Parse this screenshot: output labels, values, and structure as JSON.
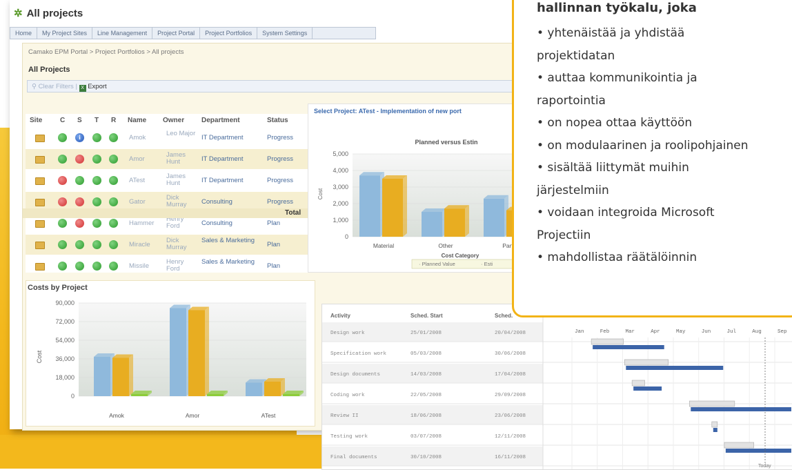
{
  "app": {
    "title": "All projects"
  },
  "nav_tabs": [
    "Home",
    "My Project Sites",
    "Line Management",
    "Project Portal",
    "Project Portfolios",
    "System Settings"
  ],
  "breadcrumb": "Camako EPM Portal > Project Portfolios > All projects",
  "section_title": "All Projects",
  "toolbar": {
    "clear_filters": "Clear Filters",
    "export": "Export"
  },
  "grid": {
    "columns": [
      "Site",
      "C",
      "S",
      "T",
      "R",
      "Name",
      "Owner",
      "Department",
      "Status"
    ],
    "rows": [
      {
        "status_dots": [
          "green",
          "info",
          "green",
          "green"
        ],
        "name": "Amok",
        "owner": "Leo Major",
        "department": "IT Department",
        "status": "Progress"
      },
      {
        "status_dots": [
          "green",
          "red",
          "green",
          "green"
        ],
        "name": "Amor",
        "owner": "James Hunt",
        "department": "IT Department",
        "status": "Progress"
      },
      {
        "status_dots": [
          "red",
          "green",
          "green",
          "green"
        ],
        "name": "ATest",
        "owner": "James Hunt",
        "department": "IT Department",
        "status": "Progress"
      },
      {
        "status_dots": [
          "red",
          "red",
          "green",
          "green"
        ],
        "name": "Gator",
        "owner": "Dick Murray",
        "department": "Consulting",
        "status": "Progress"
      },
      {
        "status_dots": [
          "green",
          "red",
          "green",
          "green"
        ],
        "name": "Hammer",
        "owner": "Henry Ford",
        "department": "Consulting",
        "status": "Plan"
      },
      {
        "status_dots": [
          "green",
          "green",
          "green",
          "green"
        ],
        "name": "Miracle",
        "owner": "Dick Murray",
        "department": "Sales & Marketing",
        "status": "Plan"
      },
      {
        "status_dots": [
          "green",
          "green",
          "green",
          "green"
        ],
        "name": "Missile",
        "owner": "Henry Ford",
        "department": "Sales & Marketing",
        "status": "Plan"
      }
    ],
    "total_label": "Total"
  },
  "costs_chart": {
    "title": "Costs by Project",
    "ylabel": "Cost",
    "yticks": [
      "90,000",
      "72,000",
      "54,000",
      "36,000",
      "18,000",
      "0"
    ],
    "categories": [
      "Amok",
      "Amor",
      "ATest"
    ],
    "series": [
      {
        "values": [
          38000,
          85000,
          13000
        ],
        "color": "#8fb9dc"
      },
      {
        "values": [
          37000,
          83000,
          14000
        ],
        "color": "#e8ad21"
      },
      {
        "values": [
          2000,
          2000,
          2000
        ],
        "color": "#8ccc3a"
      }
    ]
  },
  "select_project": {
    "title": "Select Project: ATest - Implementation of new port",
    "chart_title": "Planned versus Estin",
    "ylabel": "Cost",
    "yticks": [
      "5,000",
      "4,000",
      "3,000",
      "2,000",
      "1,000",
      "0"
    ],
    "categories": [
      "Material",
      "Other",
      "Part"
    ],
    "xlabel": "Cost Category",
    "legend": [
      "Planned Value",
      "Esti"
    ],
    "series": [
      {
        "values": [
          3700,
          1500,
          2300
        ],
        "color": "#8fb9dc"
      },
      {
        "values": [
          3500,
          1700,
          1600
        ],
        "color": "#e8ad21"
      }
    ]
  },
  "gantt": {
    "columns": [
      "Activity",
      "Sched. Start",
      "Sched."
    ],
    "rows": [
      {
        "activity": "Design work",
        "start": "25/01/2008",
        "end": "20/04/2008"
      },
      {
        "activity": "Specification work",
        "start": "05/03/2008",
        "end": "30/06/2008"
      },
      {
        "activity": "Design documents",
        "start": "14/03/2008",
        "end": "17/04/2008"
      },
      {
        "activity": "Coding work",
        "start": "22/05/2008",
        "end": "29/09/2008"
      },
      {
        "activity": "Review II",
        "start": "18/06/2008",
        "end": "23/06/2008"
      },
      {
        "activity": "Testing work",
        "start": "03/07/2008",
        "end": "12/11/2008"
      },
      {
        "activity": "Final documents",
        "start": "30/10/2008",
        "end": "16/11/2008"
      }
    ],
    "months": [
      "Jan",
      "Feb",
      "Mar",
      "Apr",
      "May",
      "Jun",
      "Jul",
      "Aug",
      "Sep"
    ],
    "today_label": "Today"
  },
  "info_box": {
    "heading": "hallinnan työkalu, joka",
    "lines": [
      "• yhtenäistää ja yhdistää",
      "projektidatan",
      "• auttaa kommunikointia ja",
      "raportointia",
      "• on nopea ottaa käyttöön",
      "• on modulaarinen ja roolipohjainen",
      "• sisältää liittymät muihin",
      "järjestelmiin",
      "• voidaan integroida Microsoft",
      "Projectiin",
      "• mahdollistaa räätälöinnin"
    ]
  }
}
